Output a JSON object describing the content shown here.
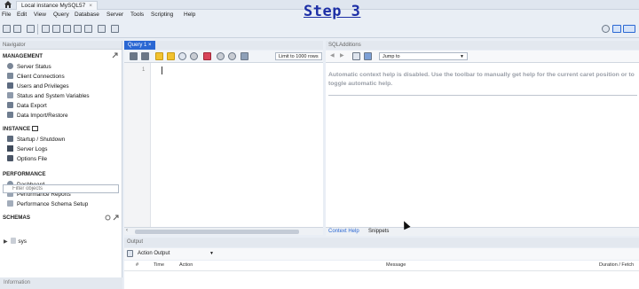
{
  "window": {
    "tab_title": "Local instance MySQL57",
    "tab_close": "×"
  },
  "banner": {
    "text": "Step 3"
  },
  "menu": [
    "File",
    "Edit",
    "View",
    "Query",
    "Database",
    "Server",
    "Tools",
    "Scripting",
    "Help"
  ],
  "navigator": {
    "header": "Navigator",
    "management_title": "MANAGEMENT",
    "management": [
      "Server Status",
      "Client Connections",
      "Users and Privileges",
      "Status and System Variables",
      "Data Export",
      "Data Import/Restore"
    ],
    "instance_title": "INSTANCE",
    "instance": [
      "Startup / Shutdown",
      "Server Logs",
      "Options File"
    ],
    "performance_title": "PERFORMANCE",
    "performance": [
      "Dashboard",
      "Performance Reports",
      "Performance Schema Setup"
    ],
    "schemas_title": "SCHEMAS",
    "filter_placeholder": "Filter objects",
    "schema": "sys",
    "information": "Information"
  },
  "editor": {
    "tab": "Query 1",
    "tab_close": "×",
    "limit": "Limit to 1000 rows",
    "line_number": "1"
  },
  "sql_additions": {
    "header": "SQLAdditions",
    "jump_to": "Jump to",
    "help_text": "Automatic context help is disabled. Use the toolbar to manually get help for the current caret position or to toggle automatic help.",
    "tabs": [
      "Context Help",
      "Snippets"
    ]
  },
  "output": {
    "header": "Output",
    "selector": "Action Output",
    "columns": [
      "#",
      "Time",
      "Action",
      "Message",
      "Duration / Fetch"
    ]
  },
  "colors": {
    "accent": "#2a67d3",
    "banner": "#1d2fa6"
  }
}
